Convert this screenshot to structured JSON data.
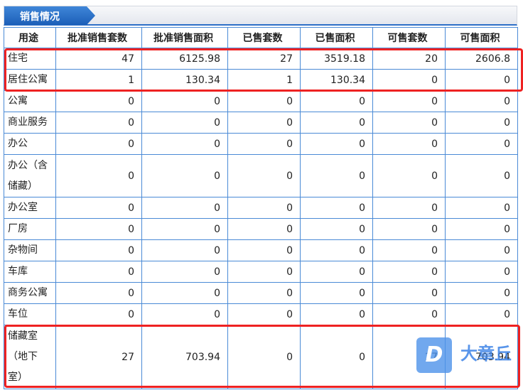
{
  "panel": {
    "title": "销售情况"
  },
  "table": {
    "headers": [
      "用途",
      "批准销售套数",
      "批准销售面积",
      "已售套数",
      "已售面积",
      "可售套数",
      "可售面积"
    ],
    "rows": [
      [
        "住宅",
        "47",
        "6125.98",
        "27",
        "3519.18",
        "20",
        "2606.8"
      ],
      [
        "居住公寓",
        "1",
        "130.34",
        "1",
        "130.34",
        "0",
        "0"
      ],
      [
        "公寓",
        "0",
        "0",
        "0",
        "0",
        "0",
        "0"
      ],
      [
        "商业服务",
        "0",
        "0",
        "0",
        "0",
        "0",
        "0"
      ],
      [
        "办公",
        "0",
        "0",
        "0",
        "0",
        "0",
        "0"
      ],
      [
        "办公（含储藏）",
        "0",
        "0",
        "0",
        "0",
        "0",
        "0"
      ],
      [
        "办公室",
        "0",
        "0",
        "0",
        "0",
        "0",
        "0"
      ],
      [
        "厂房",
        "0",
        "0",
        "0",
        "0",
        "0",
        "0"
      ],
      [
        "杂物间",
        "0",
        "0",
        "0",
        "0",
        "0",
        "0"
      ],
      [
        "车库",
        "0",
        "0",
        "0",
        "0",
        "0",
        "0"
      ],
      [
        "商务公寓",
        "0",
        "0",
        "0",
        "0",
        "0",
        "0"
      ],
      [
        "车位",
        "0",
        "0",
        "0",
        "0",
        "0",
        "0"
      ],
      [
        "储藏室（地下室）",
        "27",
        "703.94",
        "0",
        "0",
        "27",
        "703.94"
      ]
    ]
  },
  "watermark": {
    "logo": "D",
    "text": "大章丘"
  }
}
